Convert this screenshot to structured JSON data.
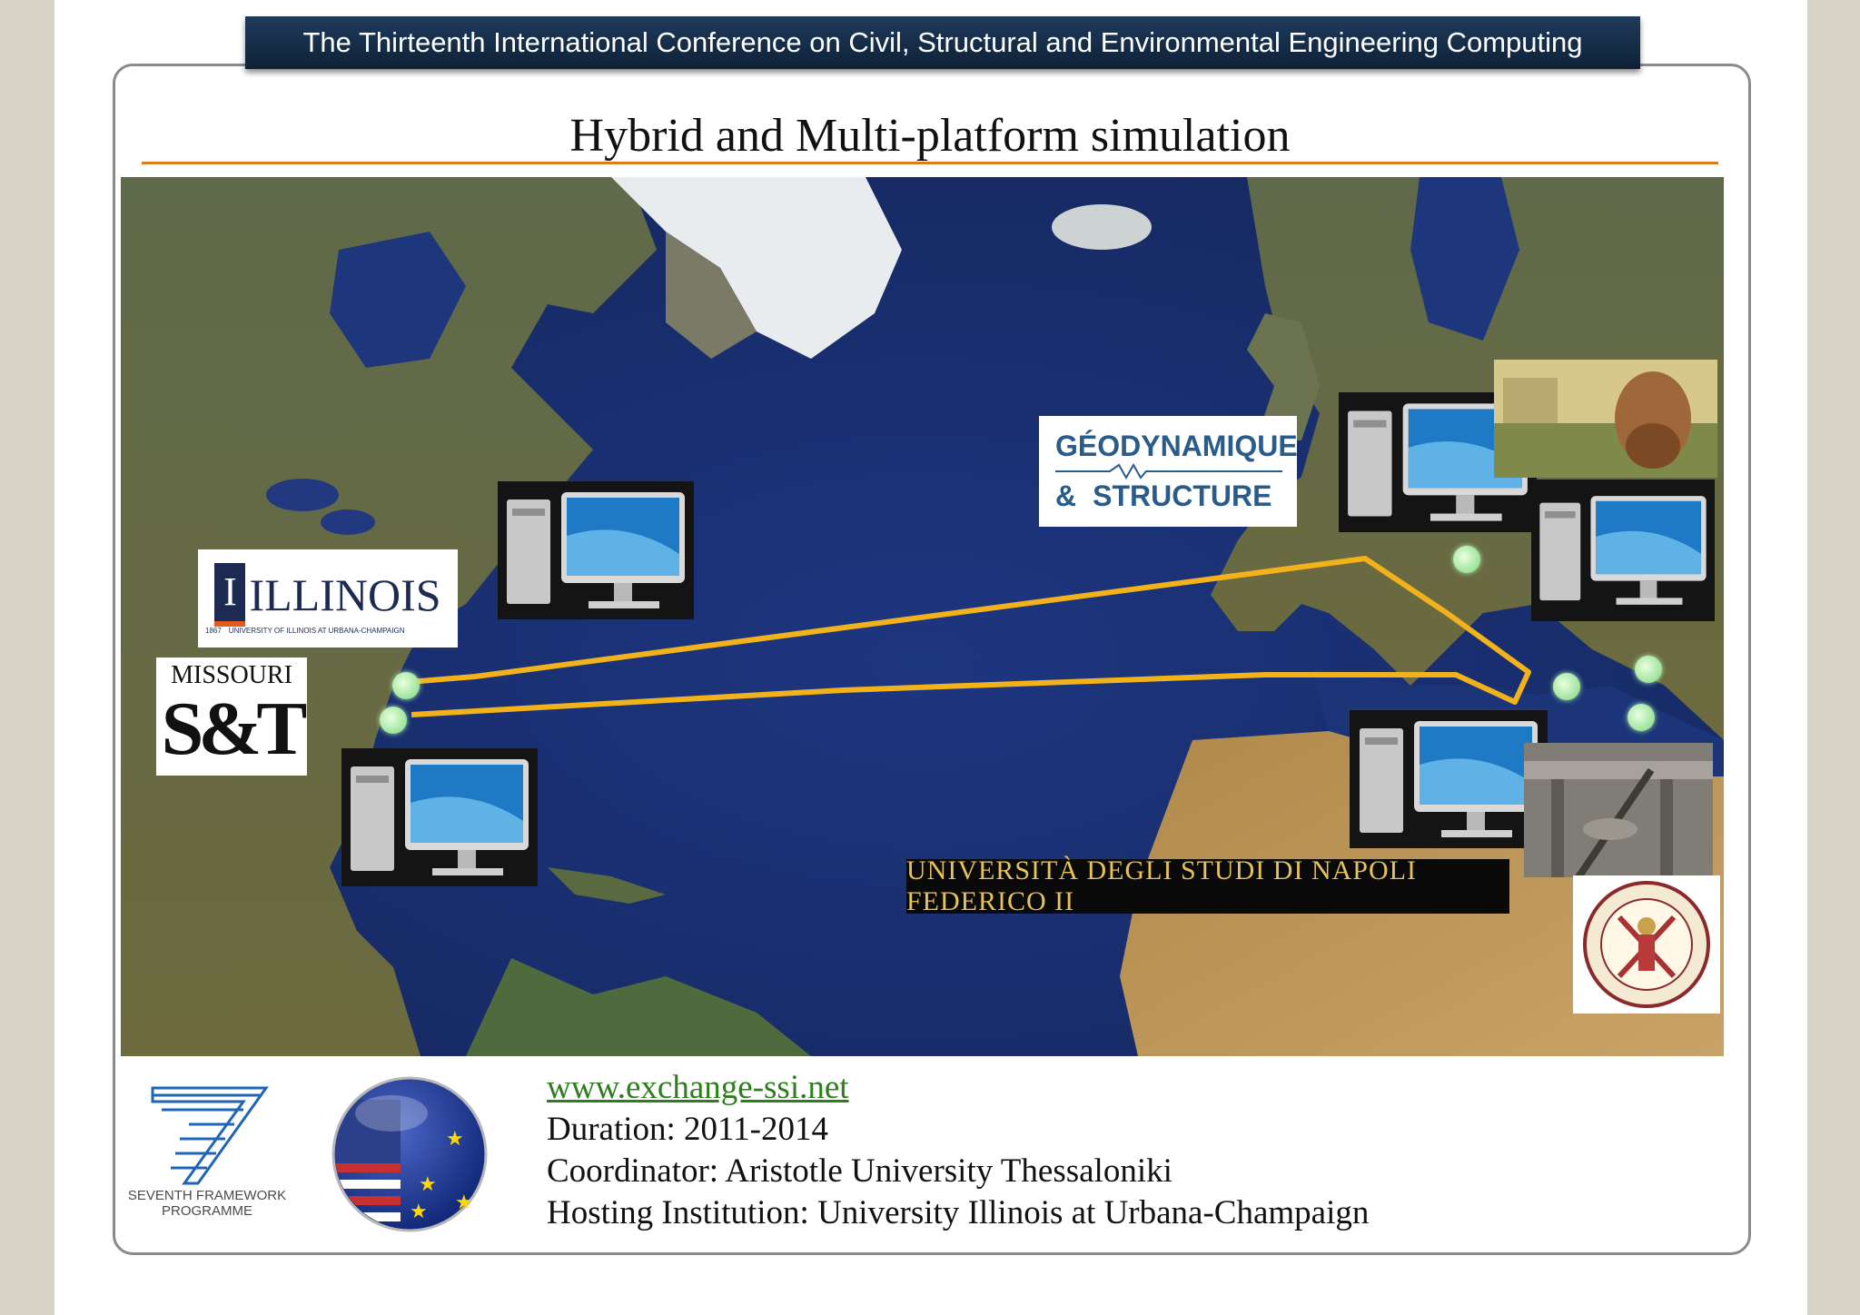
{
  "header": {
    "conference": "The Thirteenth International Conference on Civil, Structural and Environmental Engineering Computing"
  },
  "slide": {
    "title": "Hybrid and Multi-platform simulation"
  },
  "map": {
    "network_color": "#f2b21c",
    "node_color": "#9de89a",
    "logos": {
      "illinois_main": "ILLINOIS",
      "illinois_sub": "UNIVERSITY OF ILLINOIS AT URBANA-CHAMPAIGN",
      "illinois_year": "1867",
      "missouri_top": "MISSOURI",
      "missouri_main": "S&T",
      "geodynamique_top": "GÉODYNAMIQUE",
      "geodynamique_amp": "&",
      "geodynamique_bottom": "STRUCTURE",
      "napoli": "UNIVERSITÀ DEGLI STUDI DI NAPOLI FEDERICO II"
    }
  },
  "footer": {
    "fp7_label_1": "SEVENTH FRAMEWORK",
    "fp7_label_2": "PROGRAMME",
    "link": "www.exchange-ssi.net",
    "duration": "Duration: 2011-2014",
    "coordinator": "Coordinator: Aristotle University Thessaloniki",
    "hosting": "Hosting Institution: University Illinois at Urbana-Champaign"
  }
}
